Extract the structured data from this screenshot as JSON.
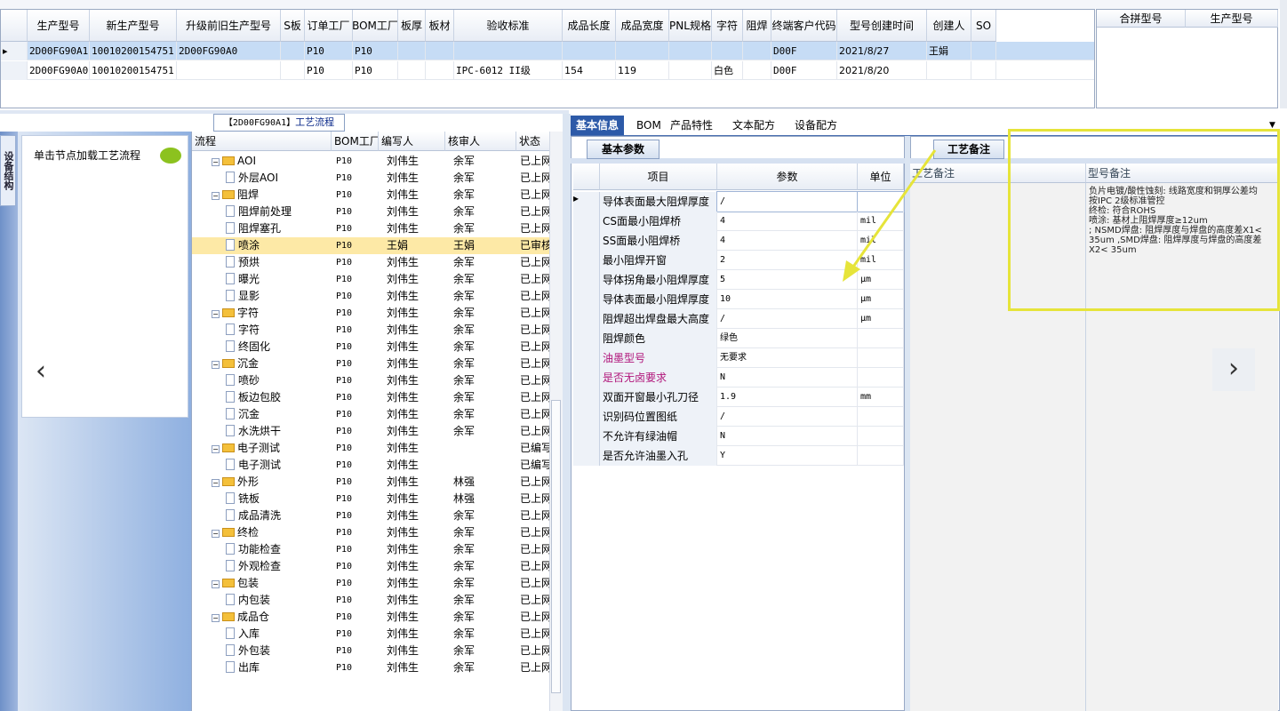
{
  "top_grid": {
    "headers": [
      "生产型号",
      "新生产型号",
      "升级前旧生产型号",
      "S板",
      "订单工厂",
      "BOM工厂",
      "板厚",
      "板材",
      "验收标准",
      "成品长度",
      "成品宽度",
      "PNL规格",
      "字符",
      "阻焊",
      "终端客户代码",
      "型号创建时间",
      "创建人",
      "SO"
    ],
    "rows": [
      [
        "2D00FG90A1",
        "10010200154751",
        "2D00FG90A0",
        "",
        "P10",
        "P10",
        "",
        "",
        "",
        "",
        "",
        "",
        "",
        "",
        "D00F",
        "2021/8/27",
        "王娟",
        ""
      ],
      [
        "2D00FG90A0",
        "10010200154751",
        "",
        "",
        "P10",
        "P10",
        "",
        "",
        "IPC-6012 II级",
        "154",
        "119",
        "",
        "白色",
        "",
        "D00F",
        "2021/8/20",
        "",
        ""
      ]
    ]
  },
  "merge_grid": {
    "headers": [
      "合拼型号",
      "生产型号"
    ]
  },
  "left_drawer": {
    "tab_label": "设备结构",
    "hint": "单击节点加载工艺流程",
    "prev": "‹"
  },
  "process_tab": {
    "prefix": "【2D00FG90A1】",
    "title": "工艺流程"
  },
  "tree": {
    "headers": [
      "流程",
      "BOM工厂",
      "编写人",
      "核审人",
      "状态"
    ],
    "rows": [
      {
        "level": 0,
        "type": "folder",
        "name": "AOI",
        "bom": "P10",
        "writer": "刘伟生",
        "reviewer": "余军",
        "status": "已上网"
      },
      {
        "level": 1,
        "type": "doc",
        "name": "外层AOI",
        "bom": "P10",
        "writer": "刘伟生",
        "reviewer": "余军",
        "status": "已上网"
      },
      {
        "level": 0,
        "type": "folder",
        "name": "阻焊",
        "bom": "P10",
        "writer": "刘伟生",
        "reviewer": "余军",
        "status": "已上网"
      },
      {
        "level": 1,
        "type": "doc",
        "name": "阻焊前处理",
        "bom": "P10",
        "writer": "刘伟生",
        "reviewer": "余军",
        "status": "已上网"
      },
      {
        "level": 1,
        "type": "doc",
        "name": "阻焊塞孔",
        "bom": "P10",
        "writer": "刘伟生",
        "reviewer": "余军",
        "status": "已上网"
      },
      {
        "level": 1,
        "type": "doc",
        "name": "喷涂",
        "bom": "P10",
        "writer": "王娟",
        "reviewer": "王娟",
        "status": "已审核",
        "sel": true
      },
      {
        "level": 1,
        "type": "doc",
        "name": "预烘",
        "bom": "P10",
        "writer": "刘伟生",
        "reviewer": "余军",
        "status": "已上网"
      },
      {
        "level": 1,
        "type": "doc",
        "name": "曝光",
        "bom": "P10",
        "writer": "刘伟生",
        "reviewer": "余军",
        "status": "已上网"
      },
      {
        "level": 1,
        "type": "doc",
        "name": "显影",
        "bom": "P10",
        "writer": "刘伟生",
        "reviewer": "余军",
        "status": "已上网"
      },
      {
        "level": 0,
        "type": "folder",
        "name": "字符",
        "bom": "P10",
        "writer": "刘伟生",
        "reviewer": "余军",
        "status": "已上网"
      },
      {
        "level": 1,
        "type": "doc",
        "name": "字符",
        "bom": "P10",
        "writer": "刘伟生",
        "reviewer": "余军",
        "status": "已上网"
      },
      {
        "level": 1,
        "type": "doc",
        "name": "终固化",
        "bom": "P10",
        "writer": "刘伟生",
        "reviewer": "余军",
        "status": "已上网"
      },
      {
        "level": 0,
        "type": "folder",
        "name": "沉金",
        "bom": "P10",
        "writer": "刘伟生",
        "reviewer": "余军",
        "status": "已上网"
      },
      {
        "level": 1,
        "type": "doc",
        "name": "喷砂",
        "bom": "P10",
        "writer": "刘伟生",
        "reviewer": "余军",
        "status": "已上网"
      },
      {
        "level": 1,
        "type": "doc",
        "name": "板边包胶",
        "bom": "P10",
        "writer": "刘伟生",
        "reviewer": "余军",
        "status": "已上网"
      },
      {
        "level": 1,
        "type": "doc",
        "name": "沉金",
        "bom": "P10",
        "writer": "刘伟生",
        "reviewer": "余军",
        "status": "已上网"
      },
      {
        "level": 1,
        "type": "doc",
        "name": "水洗烘干",
        "bom": "P10",
        "writer": "刘伟生",
        "reviewer": "余军",
        "status": "已上网"
      },
      {
        "level": 0,
        "type": "folder",
        "name": "电子测试",
        "bom": "P10",
        "writer": "刘伟生",
        "reviewer": "",
        "status": "已编写"
      },
      {
        "level": 1,
        "type": "doc",
        "name": "电子测试",
        "bom": "P10",
        "writer": "刘伟生",
        "reviewer": "",
        "status": "已编写"
      },
      {
        "level": 0,
        "type": "folder",
        "name": "外形",
        "bom": "P10",
        "writer": "刘伟生",
        "reviewer": "林强",
        "status": "已上网"
      },
      {
        "level": 1,
        "type": "doc",
        "name": "铣板",
        "bom": "P10",
        "writer": "刘伟生",
        "reviewer": "林强",
        "status": "已上网"
      },
      {
        "level": 1,
        "type": "doc",
        "name": "成品清洗",
        "bom": "P10",
        "writer": "刘伟生",
        "reviewer": "余军",
        "status": "已上网"
      },
      {
        "level": 0,
        "type": "folder",
        "name": "终检",
        "bom": "P10",
        "writer": "刘伟生",
        "reviewer": "余军",
        "status": "已上网"
      },
      {
        "level": 1,
        "type": "doc",
        "name": "功能检查",
        "bom": "P10",
        "writer": "刘伟生",
        "reviewer": "余军",
        "status": "已上网"
      },
      {
        "level": 1,
        "type": "doc",
        "name": "外观检查",
        "bom": "P10",
        "writer": "刘伟生",
        "reviewer": "余军",
        "status": "已上网"
      },
      {
        "level": 0,
        "type": "folder",
        "name": "包装",
        "bom": "P10",
        "writer": "刘伟生",
        "reviewer": "余军",
        "status": "已上网"
      },
      {
        "level": 1,
        "type": "doc",
        "name": "内包装",
        "bom": "P10",
        "writer": "刘伟生",
        "reviewer": "余军",
        "status": "已上网"
      },
      {
        "level": 0,
        "type": "folder",
        "name": "成品仓",
        "bom": "P10",
        "writer": "刘伟生",
        "reviewer": "余军",
        "status": "已上网"
      },
      {
        "level": 1,
        "type": "doc",
        "name": "入库",
        "bom": "P10",
        "writer": "刘伟生",
        "reviewer": "余军",
        "status": "已上网"
      },
      {
        "level": 1,
        "type": "doc",
        "name": "外包装",
        "bom": "P10",
        "writer": "刘伟生",
        "reviewer": "余军",
        "status": "已上网"
      },
      {
        "level": 1,
        "type": "doc",
        "name": "出库",
        "bom": "P10",
        "writer": "刘伟生",
        "reviewer": "余军",
        "status": "已上网"
      }
    ]
  },
  "right_tabs": [
    "基本信息",
    "BOM",
    "产品特性",
    "文本配方",
    "设备配方"
  ],
  "basic": {
    "tab_label": "基本参数",
    "headers": [
      "项目",
      "参数",
      "单位"
    ],
    "rows": [
      {
        "item": "导体表面最大阻焊厚度",
        "value": "/",
        "unit": "",
        "current": true
      },
      {
        "item": "CS面最小阻焊桥",
        "value": "4",
        "unit": "mil"
      },
      {
        "item": "SS面最小阻焊桥",
        "value": "4",
        "unit": "mil"
      },
      {
        "item": "最小阻焊开窗",
        "value": "2",
        "unit": "mil"
      },
      {
        "item": "导体拐角最小阻焊厚度",
        "value": "5",
        "unit": "μm"
      },
      {
        "item": "导体表面最小阻焊厚度",
        "value": "10",
        "unit": "μm"
      },
      {
        "item": "阻焊超出焊盘最大高度",
        "value": "/",
        "unit": "μm"
      },
      {
        "item": "阻焊颜色",
        "value": "绿色",
        "unit": ""
      },
      {
        "item": "油墨型号",
        "value": "无要求",
        "unit": "",
        "color": "#b0157a"
      },
      {
        "item": "是否无卤要求",
        "value": "N",
        "unit": "",
        "color": "#b0157a"
      },
      {
        "item": "双面开窗最小孔刀径",
        "value": "1.9",
        "unit": "mm"
      },
      {
        "item": "识别码位置图纸",
        "value": "/",
        "unit": ""
      },
      {
        "item": "不允许有绿油帽",
        "value": "N",
        "unit": ""
      },
      {
        "item": "是否允许油墨入孔",
        "value": "Y",
        "unit": ""
      }
    ]
  },
  "memo": {
    "tab_label": "工艺备注",
    "col1_header": "工艺备注",
    "col2_header": "型号备注",
    "text": "负片电镀/酸性蚀刻: 线路宽度和铜厚公差均按IPC 2级标准管控\n终检: 符合ROHS\n喷涂: 基材上阻焊厚度≥12um\n; NSMD焊盘: 阻焊厚度与焊盘的高度差X1< 35um ,SMD焊盘: 阻焊厚度与焊盘的高度差X2< 35um"
  },
  "nav_next": "›",
  "colors": {
    "accent": "#2d5aa8",
    "selected_row": "#fde9a6",
    "highlight_box": "#e6e43a",
    "arrow": "#e6e43a"
  }
}
